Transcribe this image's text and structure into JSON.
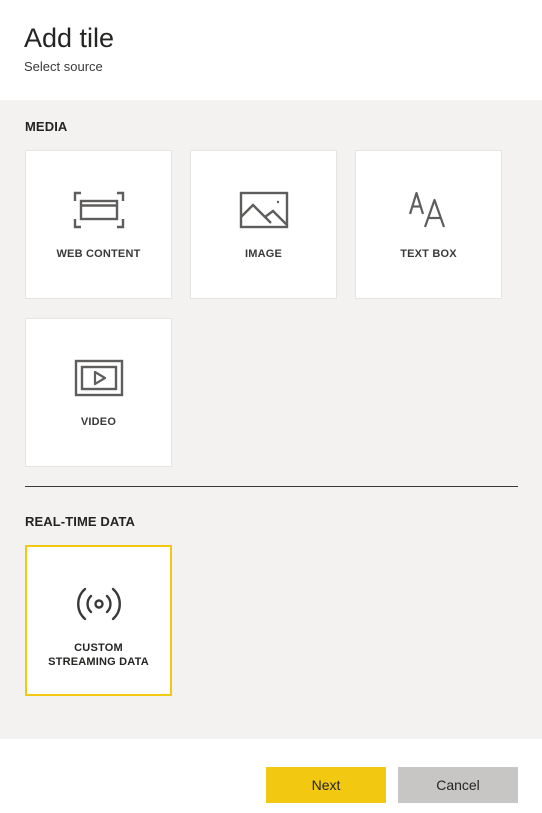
{
  "dialog": {
    "title": "Add tile",
    "subtitle": "Select source"
  },
  "sections": {
    "media": {
      "label": "MEDIA",
      "tiles": [
        {
          "label": "WEB CONTENT",
          "icon": "web-content-icon"
        },
        {
          "label": "IMAGE",
          "icon": "image-icon"
        },
        {
          "label": "TEXT BOX",
          "icon": "text-box-icon"
        },
        {
          "label": "VIDEO",
          "icon": "video-icon"
        }
      ]
    },
    "realtime": {
      "label": "REAL-TIME DATA",
      "tiles": [
        {
          "label_line1": "CUSTOM",
          "label_line2": "STREAMING DATA",
          "icon": "streaming-icon",
          "selected": true
        }
      ]
    }
  },
  "footer": {
    "next_label": "Next",
    "cancel_label": "Cancel"
  },
  "colors": {
    "accent": "#f2c811",
    "body_bg": "#f3f2f1",
    "cancel_bg": "#c8c6c4"
  }
}
